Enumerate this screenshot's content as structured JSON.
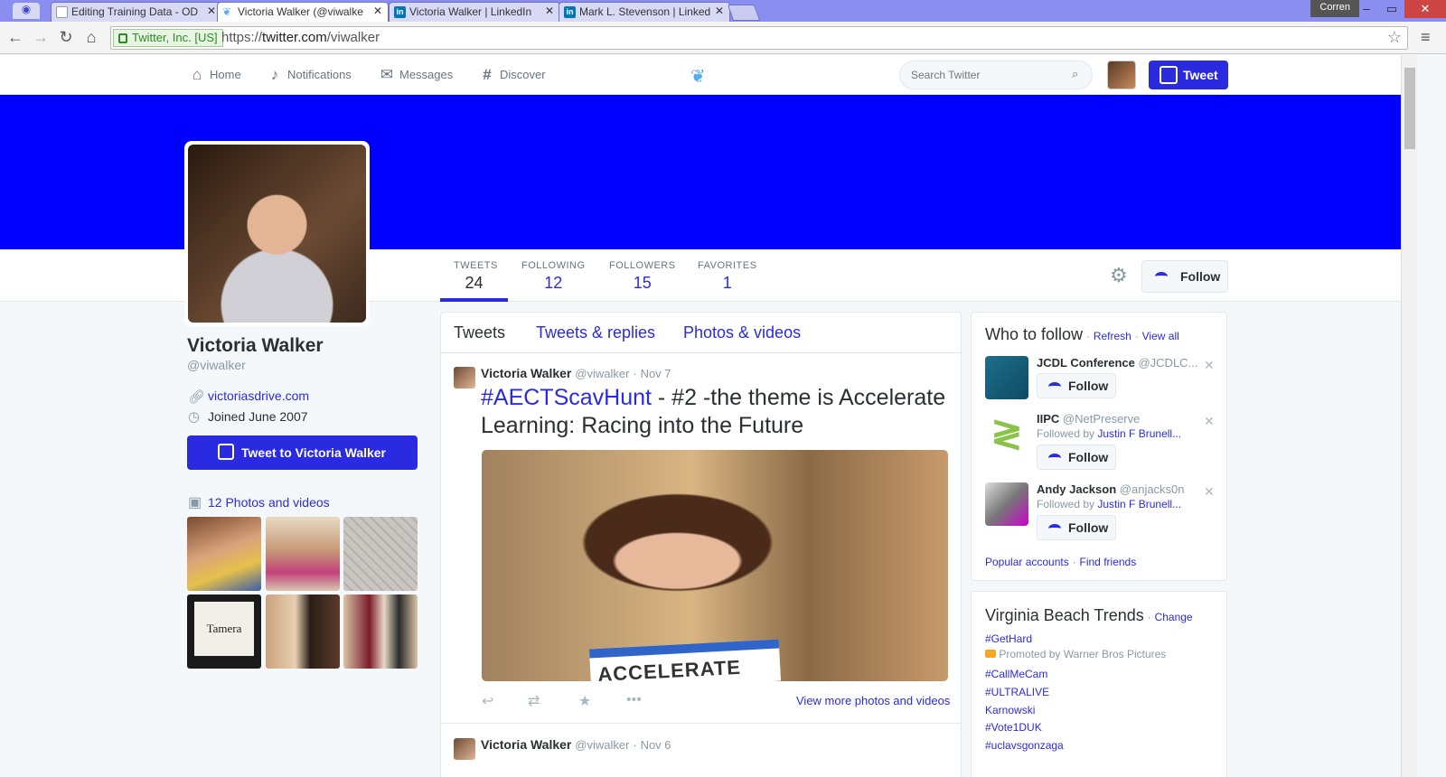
{
  "browser": {
    "tabs": [
      {
        "label": "Editing Training Data - OD",
        "icon_color": "#1a73e8"
      },
      {
        "label": "Victoria Walker (@viwalke",
        "icon_color": "#55acee"
      },
      {
        "label": "Victoria Walker | LinkedIn",
        "icon_color": "#0077b5"
      },
      {
        "label": "Mark L. Stevenson | Linked",
        "icon_color": "#0077b5"
      }
    ],
    "user_badge": "Corren",
    "ev_label": "Twitter, Inc. [US]",
    "url_scheme": "https://",
    "url_host": "twitter.com",
    "url_path": "/viwalker"
  },
  "topnav": {
    "home": "Home",
    "notifications": "Notifications",
    "messages": "Messages",
    "discover": "Discover",
    "search_placeholder": "Search Twitter",
    "tweet_button": "Tweet"
  },
  "profile": {
    "stats": [
      {
        "label": "TWEETS",
        "value": "24"
      },
      {
        "label": "FOLLOWING",
        "value": "12"
      },
      {
        "label": "FOLLOWERS",
        "value": "15"
      },
      {
        "label": "FAVORITES",
        "value": "1"
      }
    ],
    "follow_label": "Follow",
    "name": "Victoria Walker",
    "handle": "@viwalker",
    "website": "victoriasdrive.com",
    "joined": "Joined June 2007",
    "tweet_to": "Tweet to Victoria Walker",
    "photos_link": "12 Photos and videos",
    "thumb_caption": "Tamera"
  },
  "timeline": {
    "tabs": [
      "Tweets",
      "Tweets & replies",
      "Photos & videos"
    ],
    "tweets": [
      {
        "name": "Victoria Walker",
        "handle": "@viwalker",
        "date": "Nov 7",
        "hashtag": "#AECTScavHunt",
        "text": " - #2 -the theme is Accelerate Learning: Racing into the Future",
        "media_text": "ACCELERATE",
        "more_media": "View more photos and videos"
      },
      {
        "name": "Victoria Walker",
        "handle": "@viwalker",
        "date": "Nov 6"
      }
    ]
  },
  "who_to_follow": {
    "title": "Who to follow",
    "refresh": "Refresh",
    "view_all": "View all",
    "suggestions": [
      {
        "name": "JCDL Conference",
        "handle": "@JCDLC...",
        "followed_by": "",
        "follow": "Follow"
      },
      {
        "name": "IIPC",
        "handle": "@NetPreserve",
        "followed_by_prefix": "Followed by",
        "followed_by": "Justin F Brunell...",
        "follow": "Follow"
      },
      {
        "name": "Andy Jackson",
        "handle": "@anjacks0n",
        "followed_by_prefix": "Followed by",
        "followed_by": "Justin F Brunell...",
        "follow": "Follow"
      }
    ],
    "popular": "Popular accounts",
    "find_friends": "Find friends"
  },
  "trends": {
    "title": "Virginia Beach Trends",
    "change": "Change",
    "items": [
      "#GetHard",
      "#CallMeCam",
      "#ULTRALIVE",
      "Karnowski",
      "#Vote1DUK",
      "#uclavsgonzaga"
    ],
    "promoted": "Promoted by Warner Bros Pictures"
  },
  "colors": {
    "accent": "#2a2ae0",
    "banner": "#0000ff",
    "twitter_blue": "#55acee"
  }
}
